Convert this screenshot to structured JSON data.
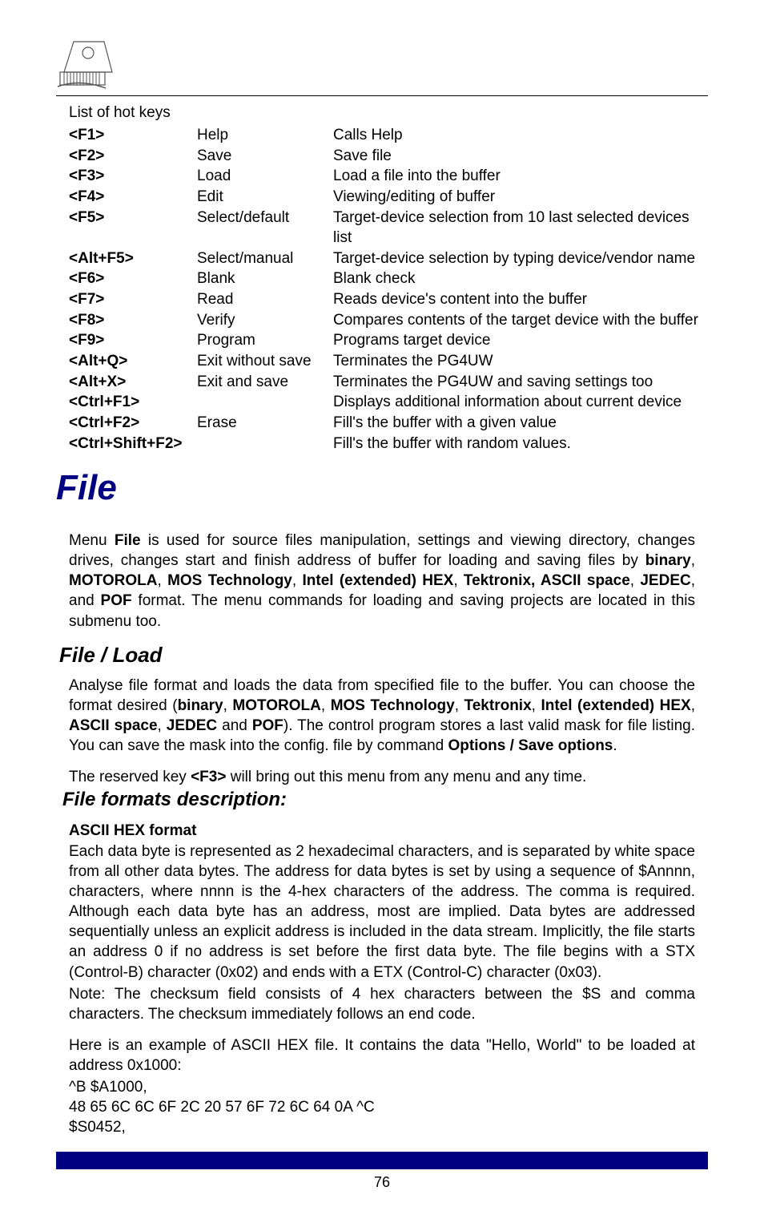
{
  "hotkeys": {
    "intro": "List of hot keys",
    "rows": [
      {
        "key": "<F1>",
        "name": "Help",
        "desc": "Calls Help"
      },
      {
        "key": "<F2>",
        "name": "Save",
        "desc": "Save file"
      },
      {
        "key": "<F3>",
        "name": "Load",
        "desc": "Load a file into the buffer"
      },
      {
        "key": "<F4>",
        "name": "Edit",
        "desc": "Viewing/editing of buffer"
      },
      {
        "key": "<F5>",
        "name": "Select/default",
        "desc": "Target-device selection from 10 last selected devices list"
      },
      {
        "key": "<Alt+F5>",
        "name": "Select/manual",
        "desc": "Target-device selection by typing device/vendor name"
      },
      {
        "key": "<F6>",
        "name": "Blank",
        "desc": "Blank check"
      },
      {
        "key": "<F7>",
        "name": "Read",
        "desc": "Reads device's content into the buffer"
      },
      {
        "key": "<F8>",
        "name": "Verify",
        "desc": "Compares contents of the target device with the buffer"
      },
      {
        "key": "<F9>",
        "name": "Program",
        "desc": "Programs target device"
      },
      {
        "key": "<Alt+Q>",
        "name": "Exit without save",
        "desc": "Terminates the PG4UW"
      },
      {
        "key": "<Alt+X>",
        "name": "Exit and save",
        "desc": "Terminates the PG4UW and saving settings too"
      },
      {
        "key": "<Ctrl+F1>",
        "name": "",
        "desc": "Displays additional information about current device"
      },
      {
        "key": "<Ctrl+F2>",
        "name": "Erase",
        "desc": "Fill's the buffer with a given value"
      },
      {
        "key": "<Ctrl+Shift+F2>",
        "name": "",
        "desc": "Fill's the buffer with    random values."
      }
    ]
  },
  "headings": {
    "file": "File",
    "file_load": "File / Load",
    "formats": "File formats description:",
    "ascii_hex": "ASCII HEX format"
  },
  "paragraphs": {
    "menu_file_pre": "Menu ",
    "menu_file_bold1": "File",
    "menu_file_mid1": " is used for source files manipulation, settings and viewing directory, changes drives, changes start and finish address of buffer for loading and saving files by ",
    "menu_file_bold2": "binary",
    "menu_file_sep": ", ",
    "menu_file_bold3": "MOTOROLA",
    "menu_file_bold4": "MOS Technology",
    "menu_file_bold5": "Intel (extended) HEX",
    "menu_file_bold6": "Tektronix, ASCII space",
    "menu_file_bold7": "JEDEC",
    "menu_file_mid2": ", and ",
    "menu_file_bold8": "POF",
    "menu_file_post": " format. The menu commands for loading and saving projects are located in this submenu too.",
    "load_pre": "Analyse file format and loads the data from specified file to the buffer. You can choose the format desired (",
    "load_b1": "binary",
    "load_b2": "MOTOROLA",
    "load_b3": "MOS Technology",
    "load_b4": "Tektronix",
    "load_b5": "Intel (extended) HEX",
    "load_b6": "ASCII space",
    "load_b7": "JEDEC",
    "load_and": " and ",
    "load_b8": "POF",
    "load_mid": "). The control program stores a last valid mask for file listing. You can save the mask into the config. file by command ",
    "load_b9": "Options / Save options",
    "load_post": ".",
    "reserved_pre": "The reserved key ",
    "reserved_key": "<F3>",
    "reserved_post": " will bring out this menu from any menu and any time.",
    "ascii_p1": "Each data byte is represented as 2 hexadecimal characters, and is separated by white space from all other data bytes. The address for data bytes is set by using a sequence of $Annnn, characters, where nnnn is the 4-hex characters of the address. The comma is required. Although each data byte has an address, most are implied. Data bytes are addressed sequentially unless an explicit address is included in the data stream. Implicitly, the file starts an address 0 if no address is set before the first data byte. The file begins with a STX (Control-B) character (0x02) and ends with a ETX (Control-C) character (0x03).",
    "ascii_note": "Note: The checksum field consists of 4 hex characters between the $S and comma characters. The checksum immediately follows an end code.",
    "ascii_ex_intro": "Here is an example of ASCII HEX file. It contains the data \"Hello, World\" to be loaded at address 0x1000:",
    "ascii_ex_l1": "^B $A1000,",
    "ascii_ex_l2": "48 65 6C 6C 6F 2C 20 57 6F 72 6C 64 0A ^C",
    "ascii_ex_l3": "$S0452,"
  },
  "page_number": "76"
}
